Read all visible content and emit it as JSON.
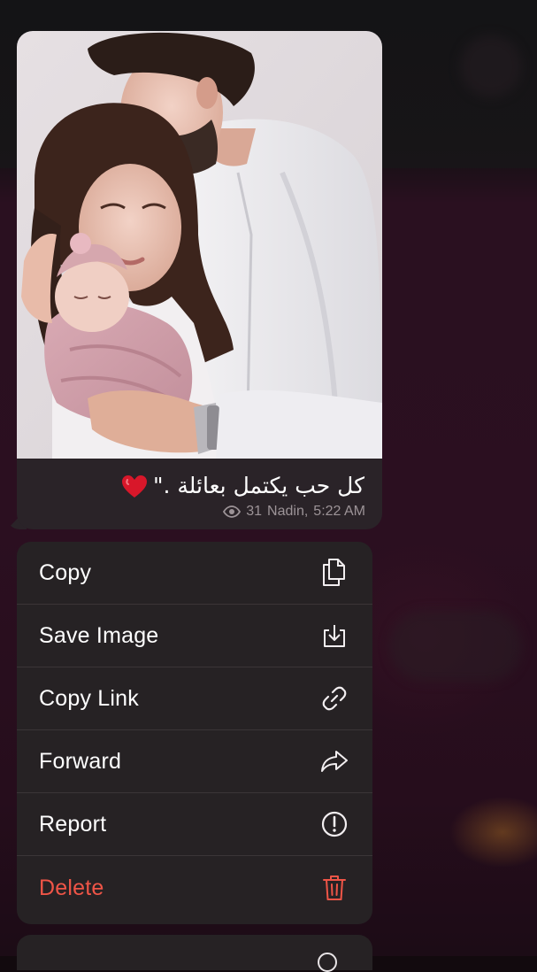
{
  "message": {
    "caption": "كل حب يكتمل بعائلة .\"",
    "heart_emoji": "heart-emoji",
    "views": "31",
    "author": "Nadin,",
    "time": "5:22 AM"
  },
  "menu": {
    "items": [
      {
        "label": "Copy",
        "icon": "copy-icon"
      },
      {
        "label": "Save Image",
        "icon": "save-image-icon"
      },
      {
        "label": "Copy Link",
        "icon": "link-icon"
      },
      {
        "label": "Forward",
        "icon": "forward-icon"
      },
      {
        "label": "Report",
        "icon": "report-icon"
      },
      {
        "label": "Delete",
        "icon": "trash-icon"
      }
    ]
  },
  "colors": {
    "bubble": "#2a2328",
    "menu": "#262224",
    "danger": "#ef5547",
    "meta_text": "#9c9397"
  }
}
